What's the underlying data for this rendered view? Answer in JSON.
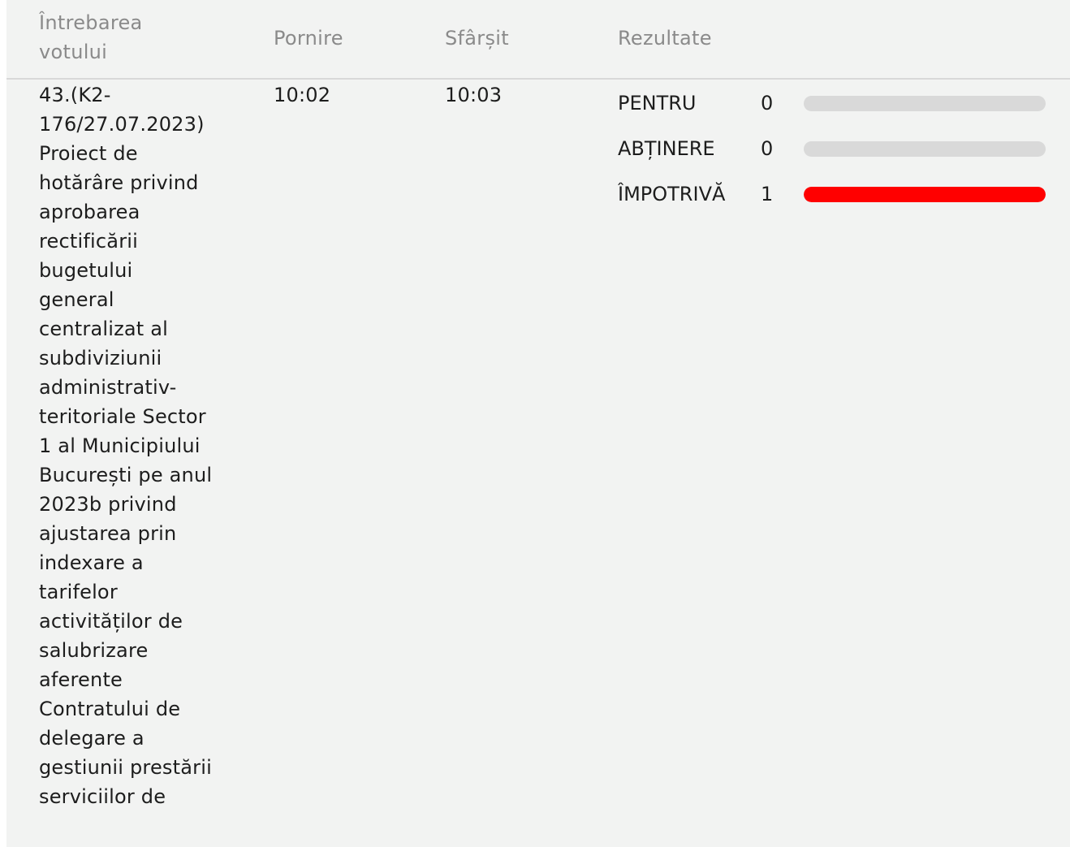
{
  "headers": {
    "question": "Întrebarea votului",
    "start": "Pornire",
    "end": "Sfârșit",
    "results": "Rezultate"
  },
  "row": {
    "question": "43.(K2-176/27.07.2023) Proiect de hotărâre privind aprobarea rectificării bugetului general centralizat al subdiviziunii administrativ-teritoriale Sector 1 al Municipiului București pe anul 2023b privind ajustarea prin indexare a tarifelor activităților de salubrizare aferente Contratului de delegare a gestiunii prestării serviciilor de",
    "start": "10:02",
    "end": "10:03",
    "results": [
      {
        "label": "PENTRU",
        "count": "0",
        "fraction": 0,
        "color": "#d9d9d9"
      },
      {
        "label": "ABȚINERE",
        "count": "0",
        "fraction": 0,
        "color": "#d9d9d9"
      },
      {
        "label": "ÎMPOTRIVĂ",
        "count": "1",
        "fraction": 1,
        "color": "#ff0000"
      }
    ]
  },
  "colors": {
    "background": "#f2f3f2",
    "header_text": "#8a8a8a",
    "body_text": "#1d1d1d",
    "track": "#d9d9d9",
    "against": "#ff0000"
  }
}
